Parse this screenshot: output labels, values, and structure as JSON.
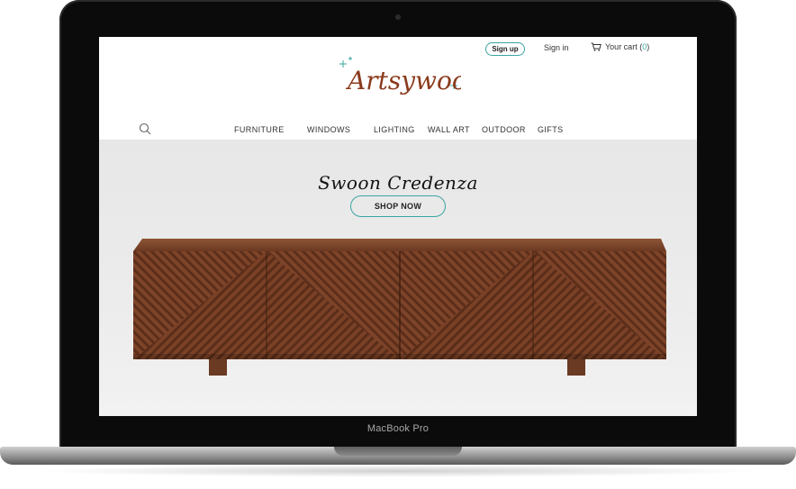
{
  "device": {
    "label": "MacBook Pro"
  },
  "header": {
    "signup_label": "Sign up",
    "signin_label": "Sign in",
    "cart_label": "Your cart (",
    "cart_count": "0",
    "cart_close": ")",
    "logo_text": "Artsywood"
  },
  "nav": {
    "items": [
      "FURNITURE",
      "WINDOWS",
      "LIGHTING",
      "WALL ART",
      "OUTDOOR",
      "GIFTS"
    ]
  },
  "hero": {
    "title": "Swoon Credenza",
    "cta_label": "SHOP NOW"
  },
  "colors": {
    "accent": "#3aa5a0",
    "logo_brown": "#8a3a1c",
    "wood": "#7a4127"
  }
}
